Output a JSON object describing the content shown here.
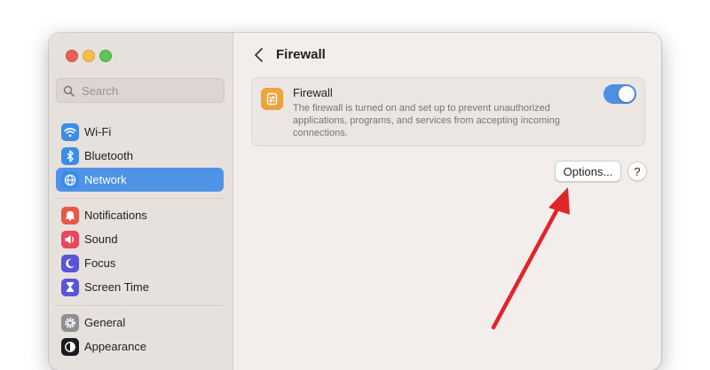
{
  "window": {
    "traffic_lights": [
      "close",
      "minimize",
      "zoom"
    ]
  },
  "sidebar": {
    "search": {
      "placeholder": "Search",
      "value": ""
    },
    "items": [
      {
        "label": "Wi-Fi",
        "icon": "wifi-icon",
        "color": "#3c8de8",
        "active": false
      },
      {
        "label": "Bluetooth",
        "icon": "bluetooth-icon",
        "color": "#3c8de8",
        "active": false
      },
      {
        "label": "Network",
        "icon": "globe-icon",
        "color": "#3c8de8",
        "active": true
      },
      {
        "label": "Notifications",
        "icon": "bell-icon",
        "color": "#e8574a",
        "active": false
      },
      {
        "label": "Sound",
        "icon": "speaker-icon",
        "color": "#e8485e",
        "active": false
      },
      {
        "label": "Focus",
        "icon": "moon-icon",
        "color": "#5a55d6",
        "active": false
      },
      {
        "label": "Screen Time",
        "icon": "hourglass-icon",
        "color": "#5a55d6",
        "active": false
      },
      {
        "label": "General",
        "icon": "gear-icon",
        "color": "#8e8e93",
        "active": false
      },
      {
        "label": "Appearance",
        "icon": "appearance-icon",
        "color": "#1c1c1e",
        "active": false
      }
    ]
  },
  "main": {
    "title": "Firewall",
    "firewall": {
      "name": "Firewall",
      "description": "The firewall is turned on and set up to prevent unauthorized applications, programs, and services from accepting incoming connections.",
      "enabled": true
    },
    "options_label": "Options...",
    "help_label": "?"
  },
  "colors": {
    "accent": "#4e93e5",
    "annotation_arrow": "#e0252b"
  }
}
